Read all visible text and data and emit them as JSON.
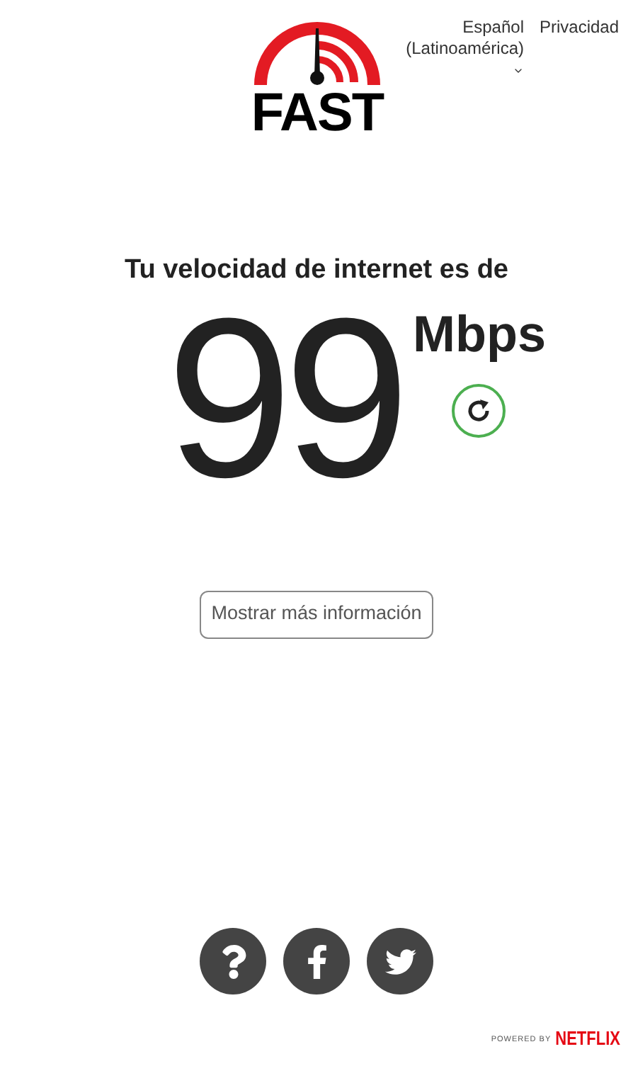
{
  "logo": {
    "text": "FAST"
  },
  "header": {
    "language": "Español (Latinoamérica)",
    "privacy": "Privacidad"
  },
  "result": {
    "heading": "Tu velocidad de internet es de",
    "speed": "99",
    "unit": "Mbps"
  },
  "more_button": "Mostrar más información",
  "footer": {
    "powered_by": "POWERED BY",
    "brand": "NETFLIX"
  }
}
